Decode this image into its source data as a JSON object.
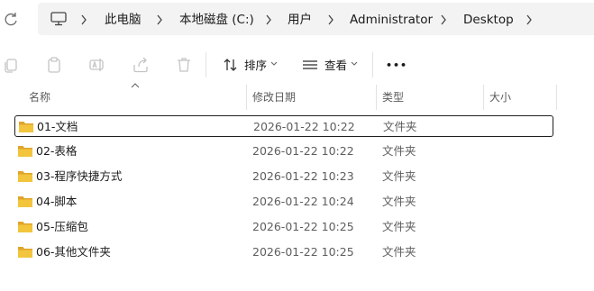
{
  "address_bar": {
    "breadcrumbs": [
      "此电脑",
      "本地磁盘 (C:)",
      "用户",
      "Administrator",
      "Desktop"
    ]
  },
  "toolbar": {
    "sort_label": "排序",
    "view_label": "查看",
    "more_label": "•••"
  },
  "columns": {
    "name": "名称",
    "date": "修改日期",
    "type": "类型",
    "size": "大小"
  },
  "files": [
    {
      "name": "01-文档",
      "date": "2026-01-22 10:22",
      "type": "文件夹"
    },
    {
      "name": "02-表格",
      "date": "2026-01-22 10:22",
      "type": "文件夹"
    },
    {
      "name": "03-程序快捷方式",
      "date": "2026-01-22 10:23",
      "type": "文件夹"
    },
    {
      "name": "04-脚本",
      "date": "2026-01-22 10:24",
      "type": "文件夹"
    },
    {
      "name": "05-压缩包",
      "date": "2026-01-22 10:25",
      "type": "文件夹"
    },
    {
      "name": "06-其他文件夹",
      "date": "2026-01-22 10:25",
      "type": "文件夹"
    }
  ],
  "colors": {
    "folder": "#f2c53d",
    "folder_back": "#dfa52a",
    "selection_border": "#1f1f1f",
    "address_bg": "#f3f3f3"
  }
}
